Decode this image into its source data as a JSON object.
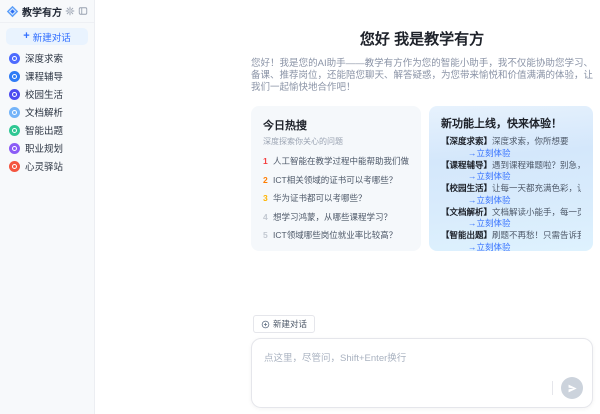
{
  "colors": {
    "accent": "#3370ff",
    "sidebar_bg": "#f7f9fb",
    "hot_card_bg": "#f5f8fb",
    "feature_card_gradient": [
      "#e7f2fd",
      "#d4e7fb",
      "#def2fe"
    ],
    "link_blue": "#3370ff"
  },
  "sidebar": {
    "app_title": "教学有方",
    "new_chat_label": "新建对话",
    "items": [
      {
        "label": "深度求索",
        "icon": "deepseek-icon",
        "color": "#4d6bfe"
      },
      {
        "label": "课程辅导",
        "icon": "course-icon",
        "color": "#2f7cf6"
      },
      {
        "label": "校园生活",
        "icon": "campus-icon",
        "color": "#4d4df0"
      },
      {
        "label": "文档解析",
        "icon": "document-icon",
        "color": "#74b4f9"
      },
      {
        "label": "智能出题",
        "icon": "quiz-icon",
        "color": "#2ec793"
      },
      {
        "label": "职业规划",
        "icon": "career-icon",
        "color": "#8b5cf6"
      },
      {
        "label": "心灵驿站",
        "icon": "mind-icon",
        "color": "#f4553f"
      }
    ]
  },
  "main": {
    "greeting_title": "您好 我是教学有方",
    "greeting_text": "您好！我是您的AI助手——教学有方作为您的智能小助手，我不仅能协助您学习、备课、推荐岗位，还能陪您聊天、解答疑惑，为您带来愉悦和价值满满的体验，让我们一起愉快地合作吧！",
    "hot_card": {
      "title": "今日热搜",
      "subtitle": "深度探索你关心的问题",
      "items": [
        {
          "rank": "1",
          "color": "#f53f3f",
          "text": "人工智能在教学过程中能帮助我们做什么？"
        },
        {
          "rank": "2",
          "color": "#ff7d00",
          "text": "ICT相关领域的证书可以考哪些？"
        },
        {
          "rank": "3",
          "color": "#ffb400",
          "text": "华为证书都可以考哪些？"
        },
        {
          "rank": "4",
          "color": "#c2c8d1",
          "text": "想学习鸿蒙，从哪些课程学习？"
        },
        {
          "rank": "5",
          "color": "#c2c8d1",
          "text": "ICT领域哪些岗位就业率比较高？"
        }
      ]
    },
    "feature_card": {
      "title": "新功能上线，快来体验！",
      "cta": "→立刻体验",
      "items": [
        {
          "tag": "【深度求索】",
          "desc": "深度求索，你所想要"
        },
        {
          "tag": "【课程辅导】",
          "desc": "遇到课程难题啦？别急，我在..."
        },
        {
          "tag": "【校园生活】",
          "desc": "让每一天都充满色彩，让每一..."
        },
        {
          "tag": "【文档解析】",
          "desc": "文档解读小能手，每一页都轻..."
        },
        {
          "tag": "【智能出题】",
          "desc": "刷题不再愁！只需告诉我您的..."
        }
      ]
    }
  },
  "composer": {
    "new_chat_label": "新建对话",
    "placeholder": "点这里，尽管问，Shift+Enter换行"
  }
}
